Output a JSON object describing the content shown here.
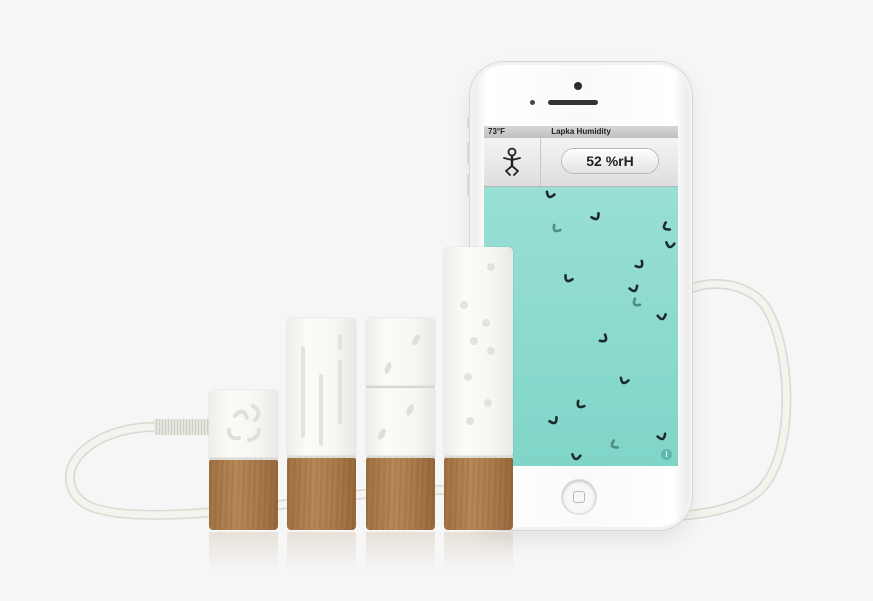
{
  "phone_app": {
    "status_bar": {
      "temperature": "73°F",
      "app_title": "Lapka Humidity"
    },
    "reading": "52 %rH",
    "info_label": "i"
  },
  "devices": [
    {
      "name": "baby-sensor"
    },
    {
      "name": "radiation-sensor"
    },
    {
      "name": "environment-sensor"
    },
    {
      "name": "organic-sensor"
    }
  ],
  "colors": {
    "background": "#f6f6f6",
    "screen_accent": "#8fdbd0",
    "wood": "#b0804f",
    "device_body": "#f6f6f3",
    "cable": "#f1f0eb"
  }
}
